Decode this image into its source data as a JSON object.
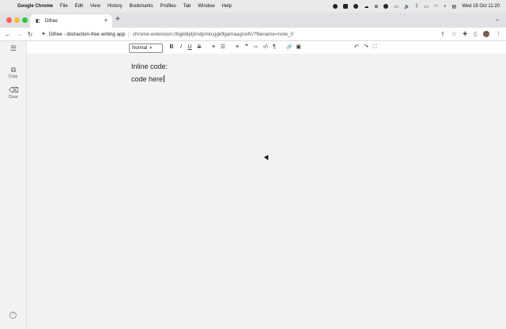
{
  "menubar": {
    "app_name": "Google Chrome",
    "items": [
      "File",
      "Edit",
      "View",
      "History",
      "Bookmarks",
      "Profiles",
      "Tab",
      "Window",
      "Help"
    ],
    "clock": "Wed 18 Oct  11:20"
  },
  "browser": {
    "tab_title": "Difree",
    "site_name": "Difree - distraction-free writing app",
    "url": "chrome-extension://bgddipljimdpmkcggkflgamaagceifc/?filename=note_0",
    "new_tab_symbol": "+",
    "tab_close_symbol": "×"
  },
  "editor": {
    "format_select_value": "Normal",
    "toolbar_buttons": [
      {
        "name": "bold-button",
        "glyph": "B"
      },
      {
        "name": "italic-button",
        "glyph": "I"
      },
      {
        "name": "underline-button",
        "glyph": "U"
      },
      {
        "name": "strikethrough-button",
        "glyph": "S"
      },
      {
        "name": "ordered-list-button",
        "glyph": "≡"
      },
      {
        "name": "bullet-list-button",
        "glyph": "☰"
      },
      {
        "name": "align-button",
        "glyph": "≡"
      },
      {
        "name": "quote-button",
        "glyph": "❞"
      },
      {
        "name": "code-inline-button",
        "glyph": "‹›"
      },
      {
        "name": "code-block-button",
        "glyph": "‹/›"
      },
      {
        "name": "direction-button",
        "glyph": "¶"
      },
      {
        "name": "link-button",
        "glyph": "🔗"
      },
      {
        "name": "image-button",
        "glyph": "▣"
      },
      {
        "name": "undo-button",
        "glyph": "↶"
      },
      {
        "name": "redo-button",
        "glyph": "↷"
      },
      {
        "name": "fullscreen-button",
        "glyph": "⛶"
      }
    ],
    "content": {
      "line1": "Inline code:",
      "line2": "code here"
    }
  },
  "sidebar": {
    "copy_label": "Copy",
    "clear_label": "Clear",
    "help_symbol": "?"
  },
  "icons": [
    "apple-icon",
    "menu-icon",
    "copy-icon",
    "clear-icon",
    "help-icon",
    "back-icon",
    "forward-icon",
    "reload-icon",
    "extension-icon",
    "share-icon",
    "star-icon",
    "puzzle-icon",
    "sidebar-icon",
    "kebab-icon"
  ]
}
